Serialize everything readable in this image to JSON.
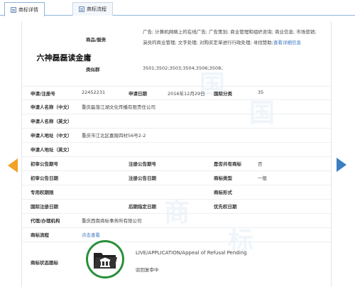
{
  "tabs": [
    {
      "label": "商标详情",
      "active": true
    },
    {
      "label": "商标流程",
      "active": false
    }
  ],
  "mark": {
    "image_text": "六神磊磊读金庸"
  },
  "goods": {
    "label": "商品/服务",
    "line1": "广告; 计算机网络上的在线广告; 广告策划; 商业管理和组织咨询; 商业信息; 市场营销;",
    "line2": "演员的商业管理; 文字处理; 对购买定单进行行政处理; 寻找赞助;",
    "detail_link": "查看详细信息"
  },
  "similar_group": {
    "label": "类似群",
    "value": "3501;3502;3503;3504;3506;3508;"
  },
  "fields": {
    "reg_no_label": "申请/注册号",
    "reg_no": "22452231",
    "app_date_label": "申请日期",
    "app_date": "2016年12月29日",
    "intl_class_label": "国际分类",
    "intl_class": "35",
    "applicant_cn_label": "申请人名称（中文）",
    "applicant_cn": "重庆磊落江湖文化传播有限责任公司",
    "applicant_en_label": "申请人名称（英文）",
    "address_cn_label": "申请人地址（中文）",
    "address_cn": "重庆市江北区嘉陵四村56号2-2",
    "address_en_label": "申请人地址（英文）",
    "prelim_no_label": "初审公告期号",
    "reg_pub_no_label": "注册公告期号",
    "shared_label": "是否共有商标",
    "shared": "否",
    "prelim_date_label": "初审公告日期",
    "reg_pub_date_label": "注册公告日期",
    "mark_type_label": "商标类型",
    "mark_type": "一般",
    "exclusive_period_label": "专用权期限",
    "mark_form_label": "商标形式",
    "intl_reg_date_label": "国际注册日期",
    "later_designation_label": "后期指定日期",
    "priority_date_label": "优先权日期",
    "agent_label": "代理/办理机构",
    "agent": "重庆西南商标事务所有限公司",
    "process_label": "商标流程",
    "process_link": "点击查看",
    "status_label": "商标状态图标",
    "status_en": "LIVE/APPLICATION/Appeal of Refusal Pending",
    "status_cn": "驳回复审中"
  },
  "watermark_text": "中国商标",
  "colors": {
    "link": "#3a78c0",
    "status_ring": "#2a8f3c",
    "arrow_left": "#f2a228",
    "arrow_right": "#3a7fc4"
  }
}
